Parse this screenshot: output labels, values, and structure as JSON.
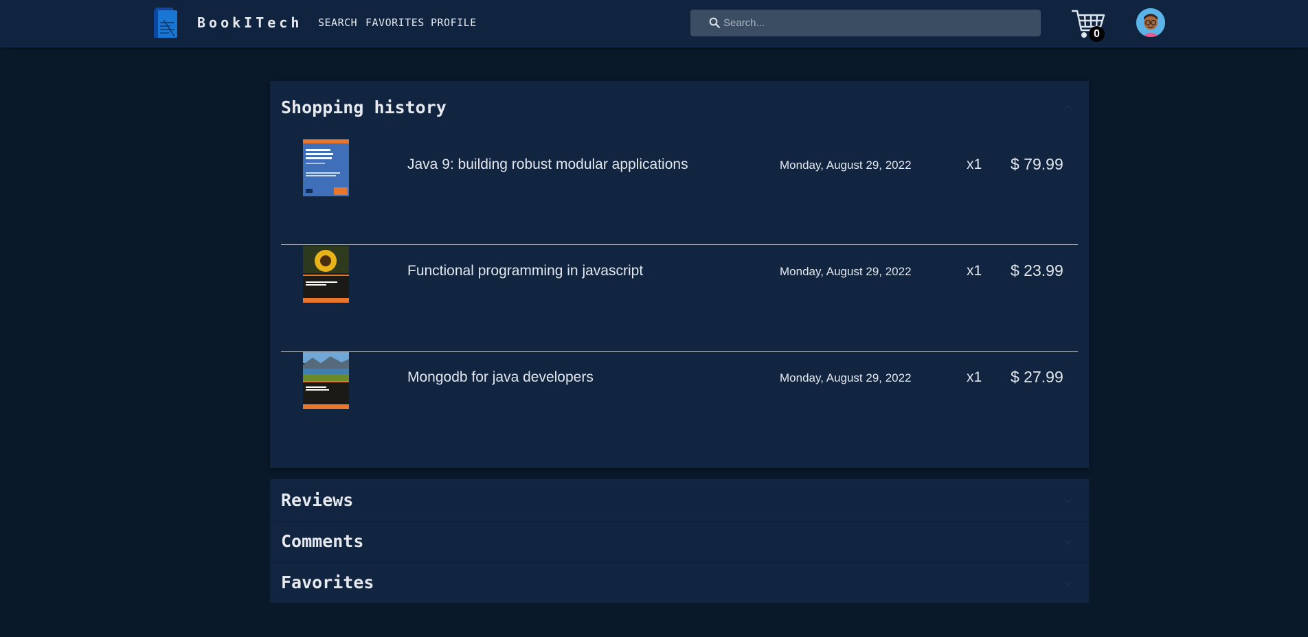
{
  "header": {
    "brand": "BookITech",
    "nav": [
      "SEARCH",
      "FAVORITES",
      "PROFILE"
    ],
    "search_placeholder": "Search...",
    "cart_count": "0"
  },
  "sections": {
    "history": {
      "title": "Shopping history",
      "expanded": true,
      "items": [
        {
          "title": "Java 9: building robust modular applications",
          "date": "Monday, August 29, 2022",
          "qty": "x1",
          "price": "$ 79.99"
        },
        {
          "title": "Functional programming in javascript",
          "date": "Monday, August 29, 2022",
          "qty": "x1",
          "price": "$ 23.99"
        },
        {
          "title": "Mongodb for java developers",
          "date": "Monday, August 29, 2022",
          "qty": "x1",
          "price": "$ 27.99"
        }
      ]
    },
    "reviews": {
      "title": "Reviews",
      "expanded": false
    },
    "comments": {
      "title": "Comments",
      "expanded": false
    },
    "favorites": {
      "title": "Favorites",
      "expanded": false
    }
  },
  "colors": {
    "background": "#0a1929",
    "header": "#102440",
    "panel": "#112440",
    "search_field": "#3a4d63",
    "text": "#e3e8ee",
    "logo_blue": "#1976d2"
  }
}
